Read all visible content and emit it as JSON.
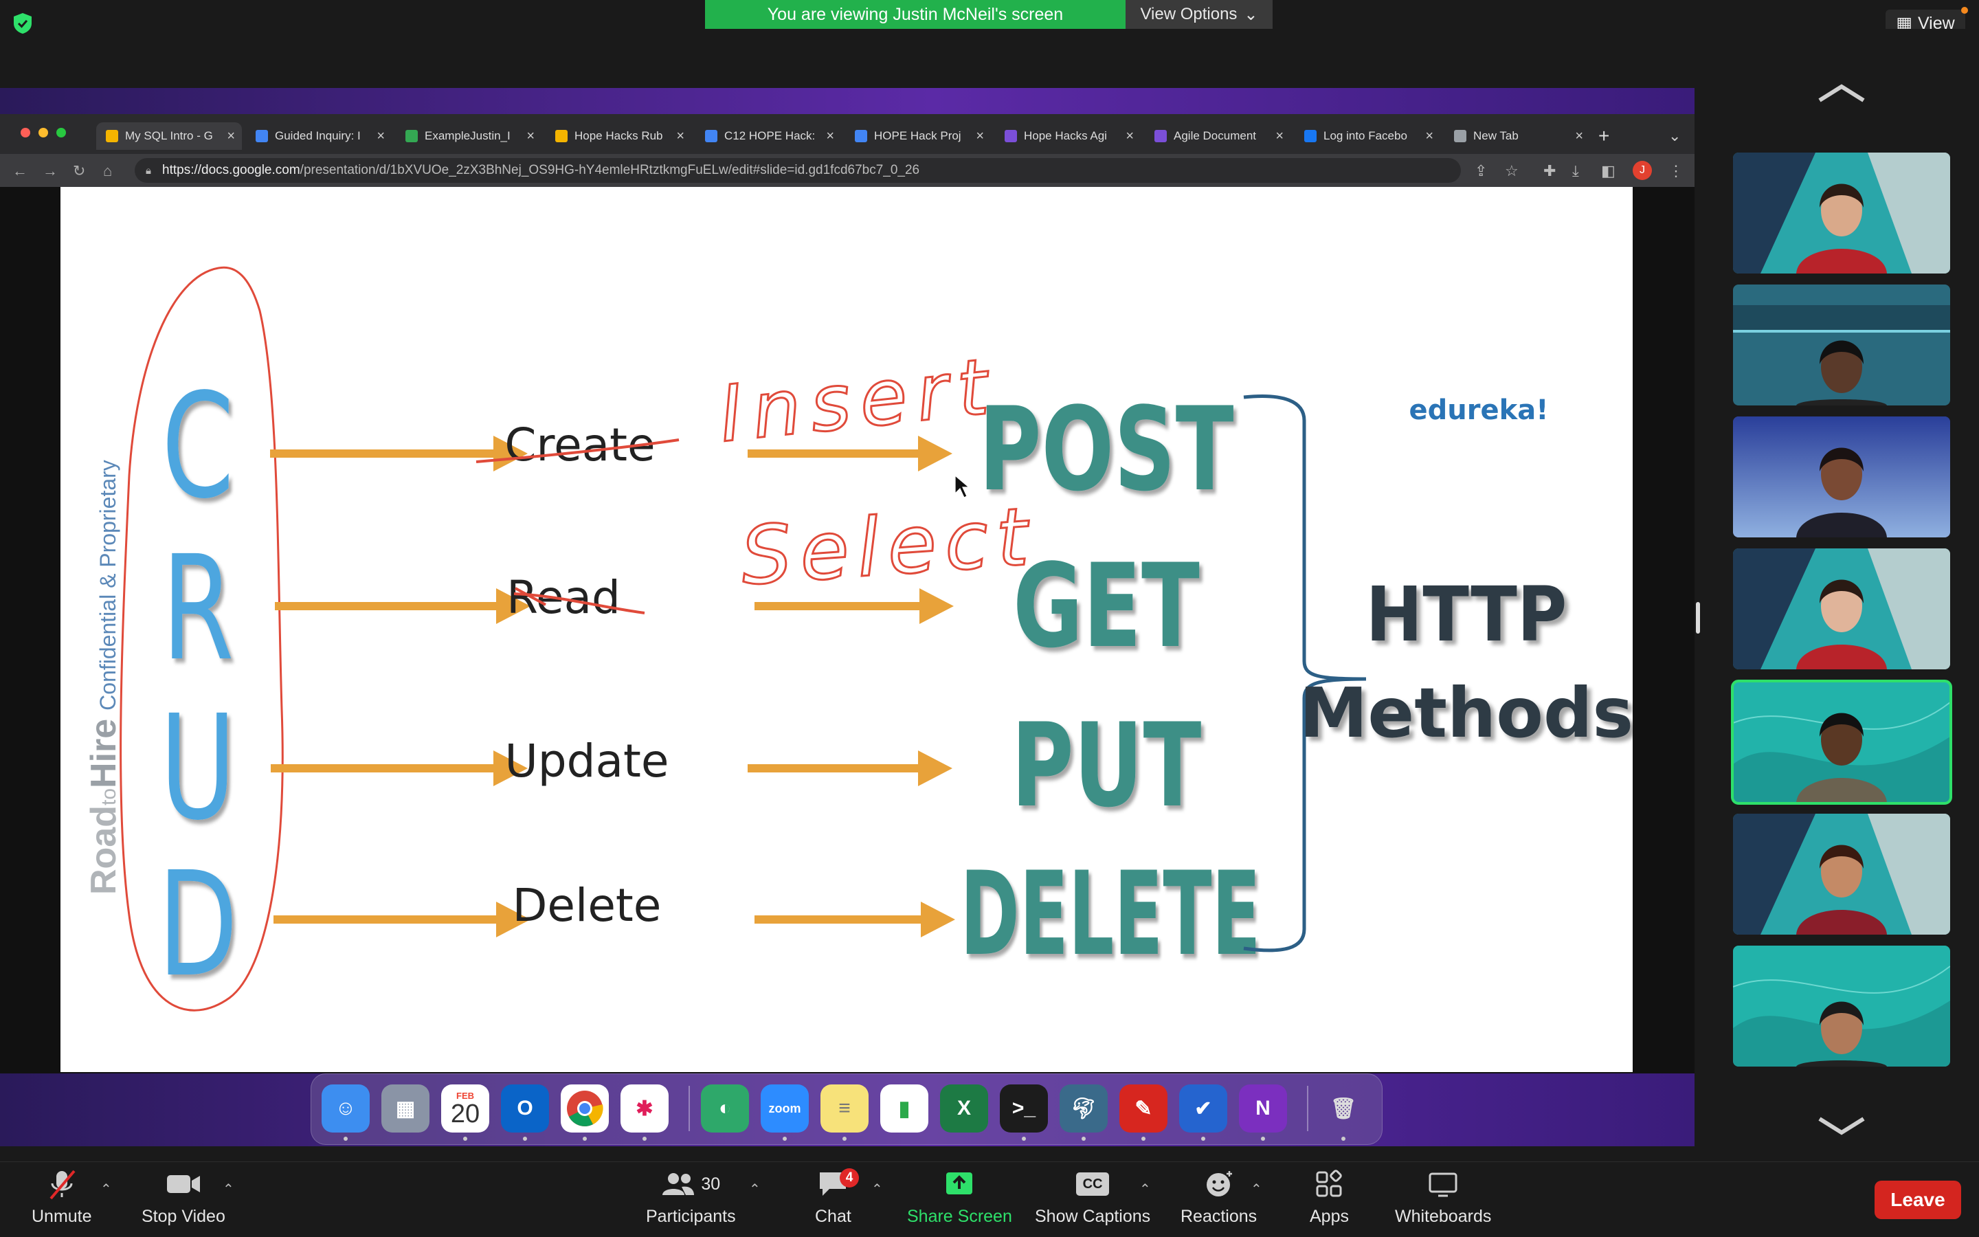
{
  "banner": {
    "viewing_text": "You are viewing Justin McNeil's screen",
    "view_options_label": "View Options",
    "view_label": "View"
  },
  "browser": {
    "tabs": [
      {
        "label": "My SQL Intro - G",
        "icon_color": "#f4b400",
        "active": true
      },
      {
        "label": "Guided Inquiry: I",
        "icon_color": "#4285f4"
      },
      {
        "label": "ExampleJustin_I",
        "icon_color": "#34a853"
      },
      {
        "label": "Hope Hacks Rub",
        "icon_color": "#f4b400"
      },
      {
        "label": "C12 HOPE Hack:",
        "icon_color": "#4285f4"
      },
      {
        "label": "HOPE Hack Proj",
        "icon_color": "#4285f4"
      },
      {
        "label": "Hope Hacks Agi",
        "icon_color": "#7b4fd8"
      },
      {
        "label": "Agile Document",
        "icon_color": "#7b4fd8"
      },
      {
        "label": "Log into Facebo",
        "icon_color": "#1877f2"
      },
      {
        "label": "New Tab",
        "icon_color": "#9aa0a6"
      }
    ],
    "url_host": "https://docs.google.com",
    "url_path": "/presentation/d/1bXVUOe_2zX3BhNej_OS9HG-hY4emleHRtztkmgFuELw/edit#slide=id.gd1fcd67bc7_0_26",
    "profile_initial": "J"
  },
  "slide": {
    "crud_letters": [
      "C",
      "R",
      "U",
      "D"
    ],
    "operations": [
      "Create",
      "Read",
      "Update",
      "Delete"
    ],
    "http_methods": [
      "POST",
      "GET",
      "PUT",
      "DELETE"
    ],
    "http_heading_line1": "HTTP",
    "http_heading_line2": "Methods",
    "brand": "edureka!",
    "watermark_road": "Road",
    "watermark_to": "to",
    "watermark_hire": "Hire",
    "watermark_conf": "Confidential & Proprietary",
    "annotation_insert": "Insert",
    "annotation_select": "Select"
  },
  "dock": {
    "calendar_month": "FEB",
    "calendar_day": "20",
    "zoom_label": "zoom"
  },
  "toolbar": {
    "unmute": "Unmute",
    "stop_video": "Stop Video",
    "participants": "Participants",
    "participants_count": "30",
    "chat": "Chat",
    "chat_badge": "4",
    "share_screen": "Share Screen",
    "show_captions": "Show Captions",
    "cc": "CC",
    "reactions": "Reactions",
    "apps": "Apps",
    "whiteboards": "Whiteboards",
    "leave": "Leave"
  },
  "colors": {
    "zoom_green": "#2ee06a",
    "banner_green": "#22b14c",
    "leave_red": "#d4251f",
    "crud_blue": "#4da6df",
    "method_teal": "#3e8f86",
    "arrow_orange": "#e8a23a",
    "annotation_red": "#e04a3a"
  }
}
